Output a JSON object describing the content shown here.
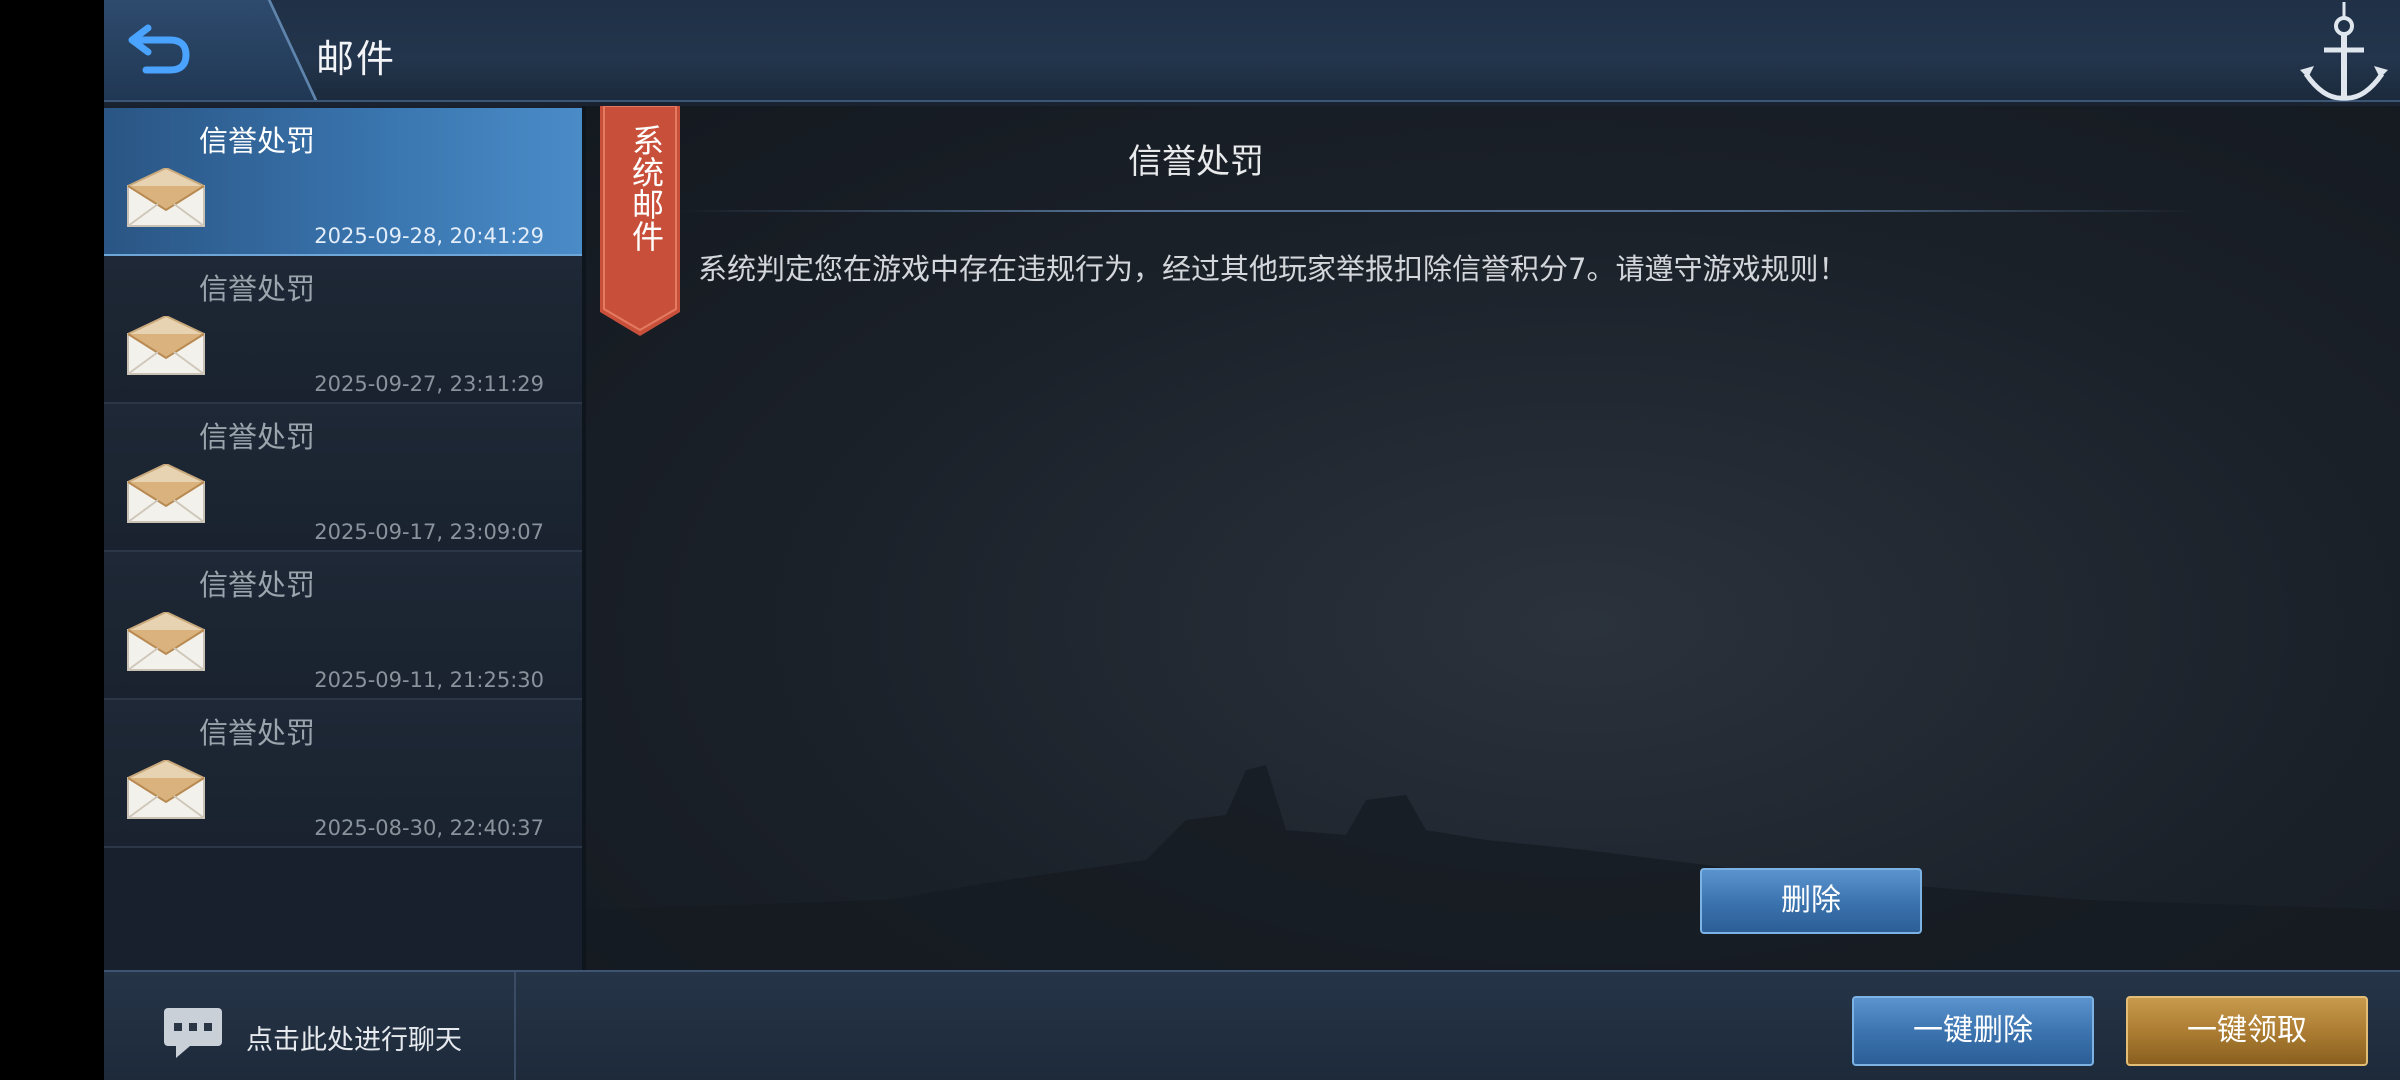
{
  "header": {
    "title": "邮件"
  },
  "mail_list": [
    {
      "title": "信誉处罚",
      "date": "2025-09-28, 20:41:29",
      "selected": true
    },
    {
      "title": "信誉处罚",
      "date": "2025-09-27, 23:11:29",
      "selected": false
    },
    {
      "title": "信誉处罚",
      "date": "2025-09-17, 23:09:07",
      "selected": false
    },
    {
      "title": "信誉处罚",
      "date": "2025-09-11, 21:25:30",
      "selected": false
    },
    {
      "title": "信誉处罚",
      "date": "2025-08-30, 22:40:37",
      "selected": false
    }
  ],
  "content": {
    "ribbon_label": "系统邮件",
    "title": "信誉处罚",
    "body": "系统判定您在游戏中存在违规行为，经过其他玩家举报扣除信誉积分7。请遵守游戏规则！",
    "delete_label": "删除"
  },
  "footer": {
    "chat_label": "点击此处进行聊天",
    "delete_all_label": "一键删除",
    "claim_all_label": "一键领取"
  },
  "colors": {
    "accent_blue": "#3a76b0",
    "ribbon_red": "#c8503a",
    "gold": "#a97a30"
  },
  "icons": [
    "back-arrow-icon",
    "anchor-icon",
    "envelope-icon",
    "chat-bubble-icon"
  ]
}
